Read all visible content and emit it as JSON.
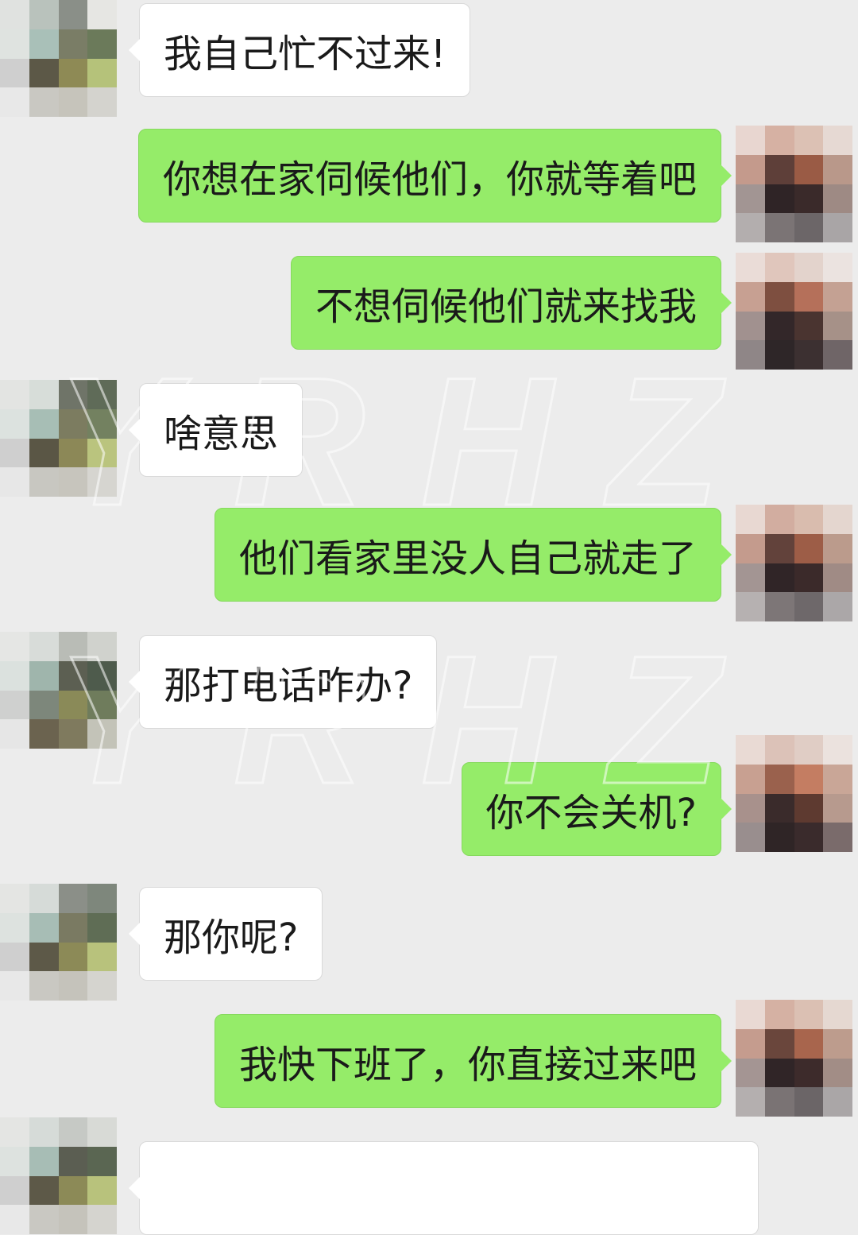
{
  "chat": {
    "messages": [
      {
        "side": "in",
        "text": "我自己忙不过来!"
      },
      {
        "side": "out",
        "text": "你想在家伺候他们，你就等着吧"
      },
      {
        "side": "out",
        "text": "不想伺候他们就来找我"
      },
      {
        "side": "in",
        "text": "啥意思"
      },
      {
        "side": "out",
        "text": "他们看家里没人自己就走了"
      },
      {
        "side": "in",
        "text": "那打电话咋办?"
      },
      {
        "side": "out",
        "text": "你不会关机?"
      },
      {
        "side": "in",
        "text": "那你呢?"
      },
      {
        "side": "out",
        "text": "我快下班了，你直接过来吧"
      }
    ]
  },
  "watermark": {
    "text": "YRHZ"
  },
  "colors": {
    "background": "#ececec",
    "incoming_bubble": "#ffffff",
    "outgoing_bubble": "#95ec69",
    "text": "#1a1a1a"
  }
}
